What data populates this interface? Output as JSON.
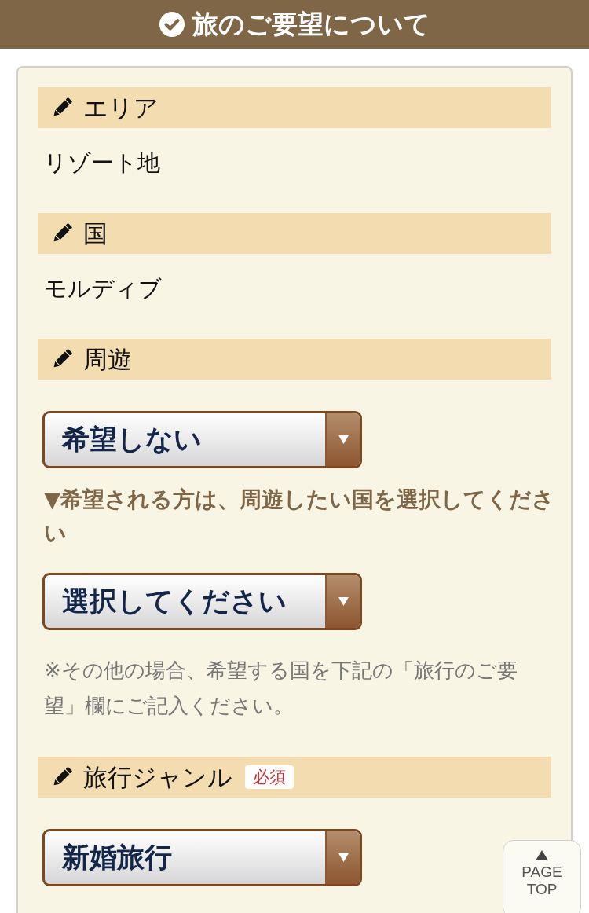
{
  "header": {
    "title": "旅のご要望について"
  },
  "sections": [
    {
      "label": "エリア",
      "items": [
        {
          "kind": "value",
          "text": "リゾート地"
        }
      ]
    },
    {
      "label": "国",
      "items": [
        {
          "kind": "value",
          "text": "モルディブ"
        }
      ]
    },
    {
      "label": "周遊",
      "items": [
        {
          "kind": "select",
          "value": "希望しない"
        },
        {
          "kind": "note",
          "text": "▼希望される方は、周遊したい国を選択してください"
        },
        {
          "kind": "select",
          "value": "選択してください"
        },
        {
          "kind": "hint",
          "text": "※その他の場合、希望する国を下記の「旅行のご要望」欄にご記入ください。"
        }
      ]
    },
    {
      "label": "旅行ジャンル",
      "badge": "必須",
      "items": [
        {
          "kind": "select",
          "value": "新婚旅行"
        }
      ]
    }
  ],
  "page_top": {
    "label": "PAGE TOP"
  }
}
